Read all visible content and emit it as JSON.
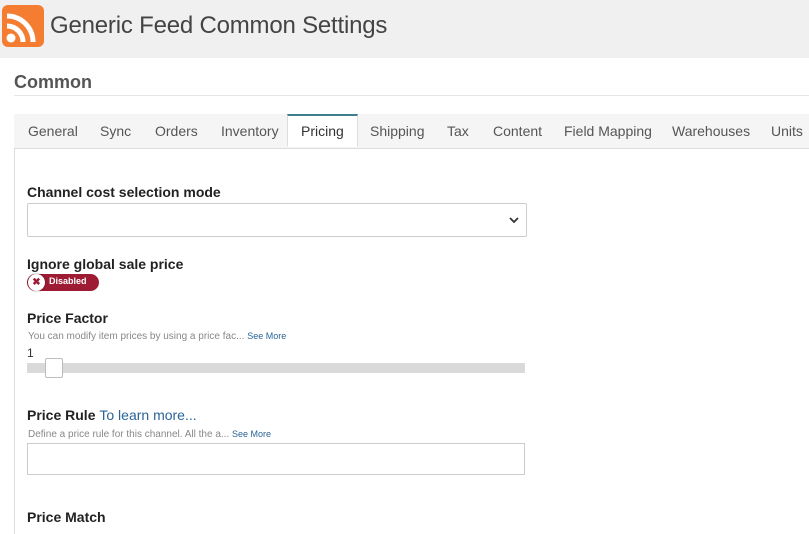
{
  "header": {
    "title": "Generic Feed Common Settings",
    "icon": "rss-icon"
  },
  "section": {
    "title": "Common"
  },
  "tabs": [
    {
      "label": "General"
    },
    {
      "label": "Sync"
    },
    {
      "label": "Orders"
    },
    {
      "label": "Inventory"
    },
    {
      "label": "Pricing",
      "active": true
    },
    {
      "label": "Shipping"
    },
    {
      "label": "Tax"
    },
    {
      "label": "Content"
    },
    {
      "label": "Field Mapping"
    },
    {
      "label": "Warehouses"
    },
    {
      "label": "Units"
    }
  ],
  "fields": {
    "cost_mode": {
      "label": "Channel cost selection mode",
      "value": ""
    },
    "ignore_sale": {
      "label": "Ignore global sale price",
      "toggle_text": "Disabled",
      "state": false
    },
    "price_factor": {
      "label": "Price Factor",
      "help": "You can modify item prices by using a price fac...",
      "see_more": "See More",
      "value": "1"
    },
    "price_rule": {
      "label": "Price Rule",
      "learn_more": "To learn more...",
      "help": "Define a price rule for this channel. All the a...",
      "see_more": "See More",
      "value": ""
    },
    "price_match": {
      "label": "Price Match"
    }
  },
  "colors": {
    "accent": "#3c7e8c",
    "toggle_off": "#9e1b34",
    "rss": "#f47d32",
    "link": "#2a6496"
  }
}
